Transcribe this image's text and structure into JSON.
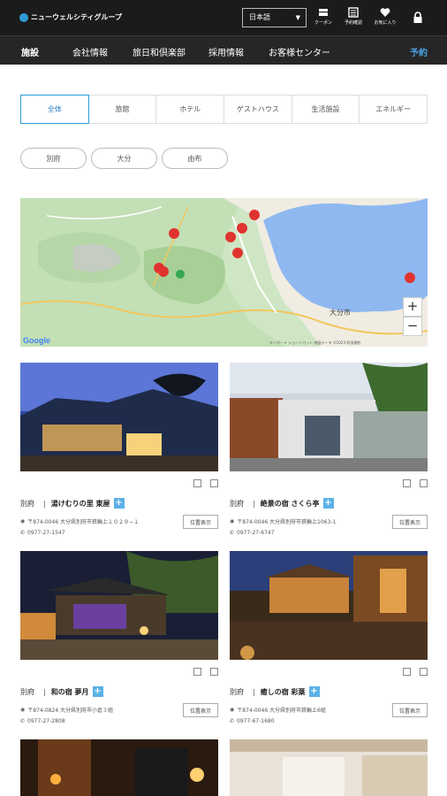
{
  "header": {
    "logo_text": "ニューウェルシティグループ",
    "language": "日本語",
    "icons": [
      {
        "name": "coupon-icon",
        "label": "クーポン"
      },
      {
        "name": "reservation-check-icon",
        "label": "予約確認"
      },
      {
        "name": "favorite-icon",
        "label": "お気に入り"
      },
      {
        "name": "lock-icon",
        "label": ""
      }
    ]
  },
  "nav": {
    "items": [
      "施設",
      "会社情報",
      "旅日和倶楽部",
      "採用情報",
      "お客様センター"
    ],
    "reserve": "予約"
  },
  "tabs": [
    "全体",
    "旅館",
    "ホテル",
    "ゲストハウス",
    "生活施設",
    "エネルギー"
  ],
  "areas": [
    "別府",
    "大分",
    "由布"
  ],
  "map": {
    "city_label": "大分市",
    "provider": "Google",
    "attribution": "キーボード ショートカット  地図データ ©2023  利用規約"
  },
  "cards": [
    {
      "area": "別府",
      "name": "湯けむりの里 東屋",
      "address": "〒874-0046 大分県別府市鉄輪上１０２９−１",
      "tel": "0977-27-1547",
      "location_button": "位置表示"
    },
    {
      "area": "別府",
      "name": "絶景の宿 さくら亭",
      "address": "〒874-0046 大分県別府市鉄輪上1063-1",
      "tel": "0977-27-6747",
      "location_button": "位置表示"
    },
    {
      "area": "別府",
      "name": "和の宿 夢月",
      "address": "〒874-0824 大分県別府市小倉３組",
      "tel": "0977-27-2808",
      "location_button": "位置表示"
    },
    {
      "area": "別府",
      "name": "癒しの宿 彩葉",
      "address": "〒874-0046 大分県別府市鉄輪上6組",
      "tel": "0977-67-1680",
      "location_button": "位置表示"
    }
  ],
  "colors": {
    "header_bg": "#1b1b1b",
    "nav_bg": "#262626",
    "accent": "#2f9bd6",
    "reserve": "#4aa3e6",
    "pin": "#e0332f",
    "sea": "#8fb8f0"
  }
}
